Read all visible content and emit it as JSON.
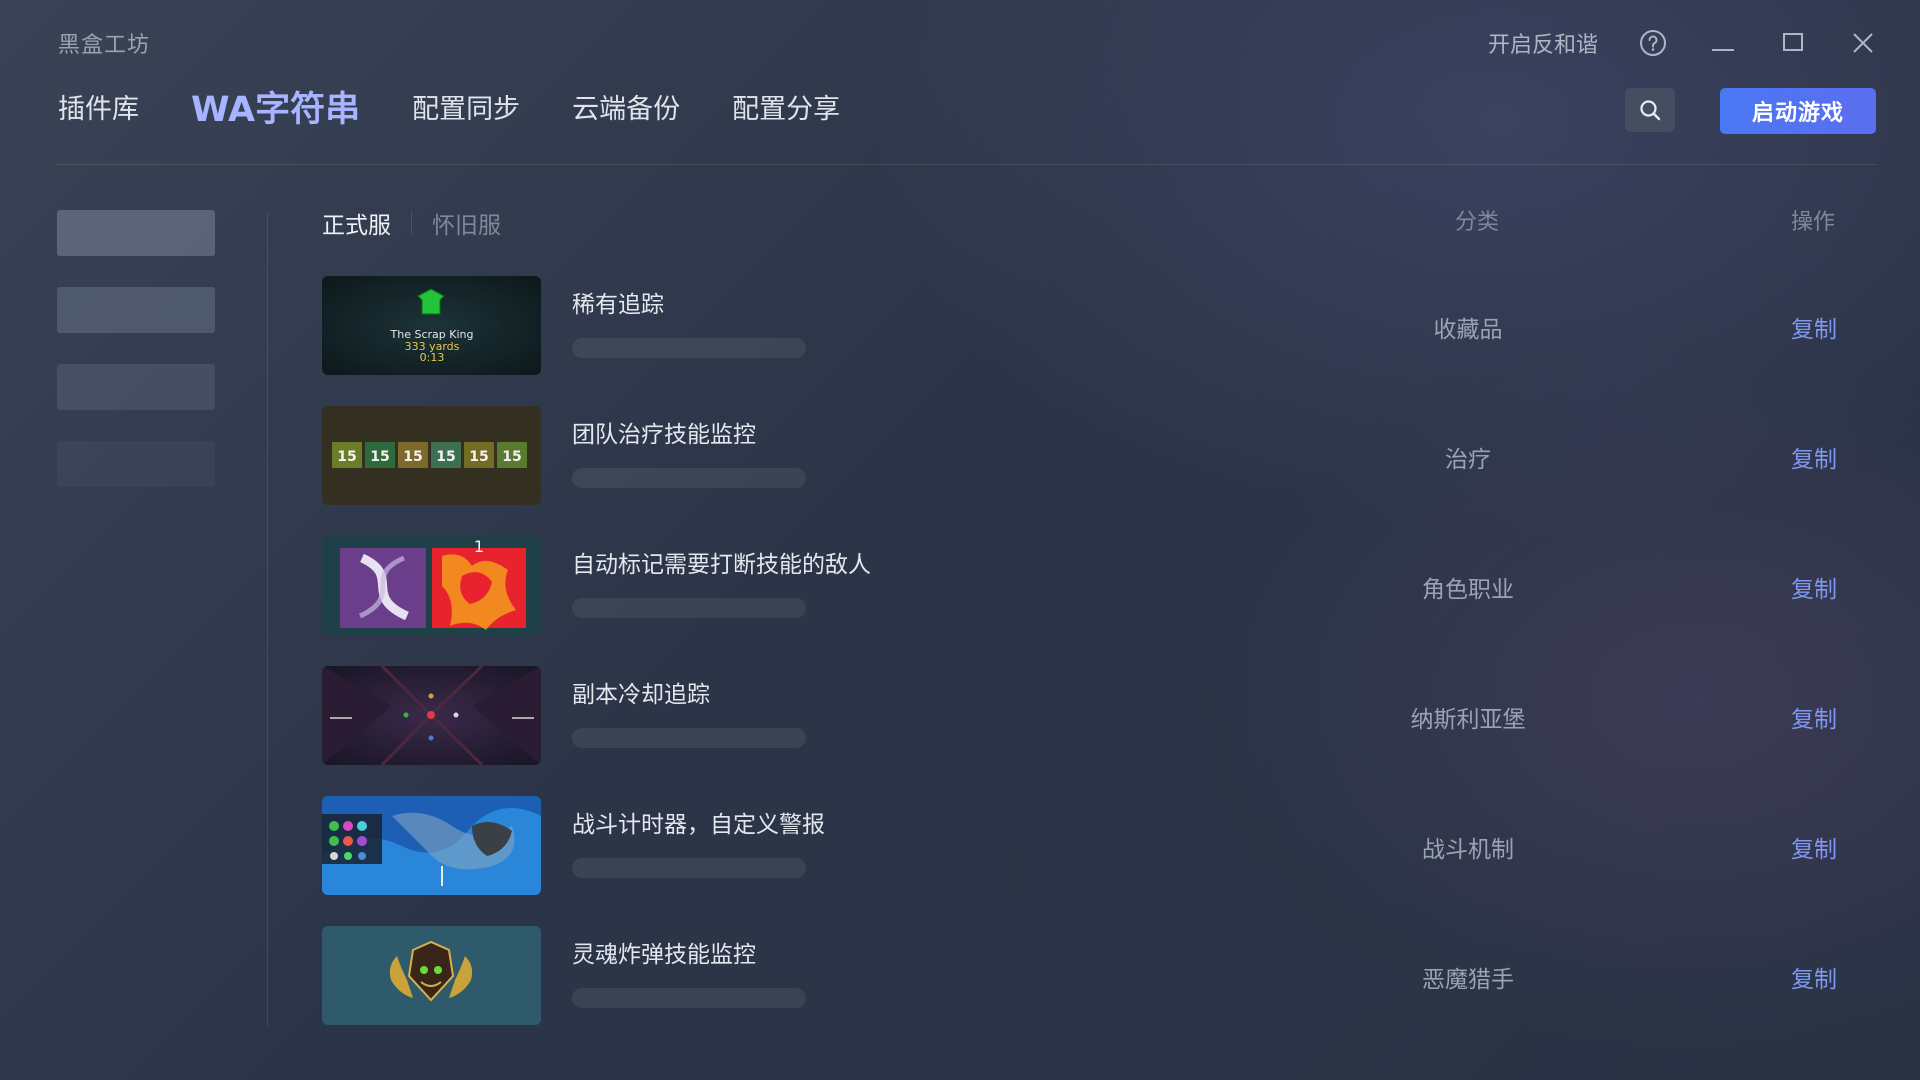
{
  "app": {
    "title": "黑盒工坊"
  },
  "titlebar": {
    "harmony_toggle": "开启反和谐",
    "icons": [
      "help-icon",
      "minimize-icon",
      "maximize-icon",
      "close-icon"
    ]
  },
  "nav": {
    "items": [
      {
        "label": "插件库",
        "active": false
      },
      {
        "label": "WA字符串",
        "active": true
      },
      {
        "label": "配置同步",
        "active": false
      },
      {
        "label": "云端备份",
        "active": false
      },
      {
        "label": "配置分享",
        "active": false
      }
    ],
    "search_icon": "search-icon",
    "launch_label": "启动游戏"
  },
  "sidebar": {
    "placeholder_opacity": [
      0.35,
      0.25,
      0.16,
      0.07
    ]
  },
  "server_tabs": [
    {
      "label": "正式服",
      "active": true
    },
    {
      "label": "怀旧服",
      "active": false
    }
  ],
  "columns": {
    "category": "分类",
    "action": "操作"
  },
  "rows": [
    {
      "title": "稀有追踪",
      "category": "收藏品",
      "action": "复制",
      "thumb_text": [
        "The Scrap King",
        "333 yards",
        "0:13"
      ]
    },
    {
      "title": "团队治疗技能监控",
      "category": "治疗",
      "action": "复制",
      "thumb_text": [
        "15",
        "15",
        "15",
        "15",
        "15",
        "15"
      ]
    },
    {
      "title": "自动标记需要打断技能的敌人",
      "category": "角色职业",
      "action": "复制",
      "thumb_text": [
        "1"
      ]
    },
    {
      "title": "副本冷却追踪",
      "category": "纳斯利亚堡",
      "action": "复制",
      "thumb_text": []
    },
    {
      "title": "战斗计时器，自定义警报",
      "category": "战斗机制",
      "action": "复制",
      "thumb_text": []
    },
    {
      "title": "灵魂炸弹技能监控",
      "category": "恶魔猎手",
      "action": "复制",
      "thumb_text": []
    }
  ],
  "colors": {
    "accent": "#a7b4ff",
    "launch_button": "#4a78f2",
    "copy_link": "#7d98f0"
  }
}
